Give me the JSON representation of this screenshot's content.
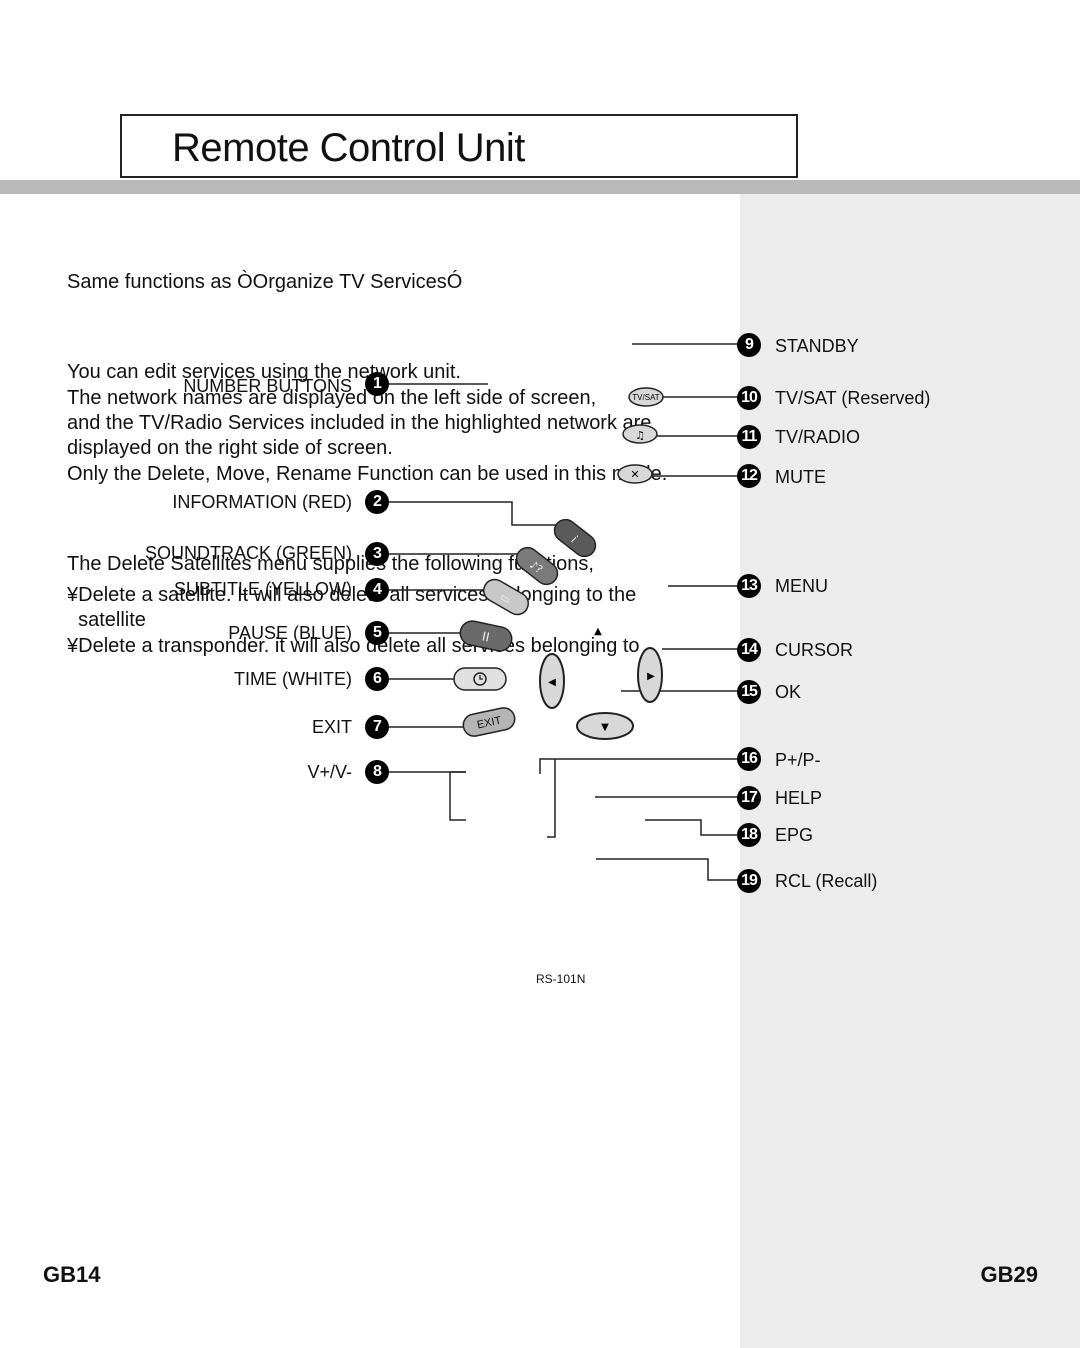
{
  "header": {
    "title": "Remote Control Unit"
  },
  "body_text": {
    "same_functions": "Same functions as ÒOrganize TV ServicesÓ",
    "paragraph1": [
      "You can edit services using the network unit.",
      "The network names are displayed on the left side of screen,",
      "and the TV/Radio Services included in the highlighted network are",
      "displayed on the right side of screen.",
      "Only the Delete, Move, Rename Function can be used in this mode."
    ],
    "paragraph2": [
      "The Delete Satellites menu supplies the following functions,",
      "¥Delete a satellite. It will also delete all services belonging to the",
      "  satellite",
      "¥Delete a transponder. it will also delete all services belonging to"
    ]
  },
  "left_callouts": [
    {
      "number": "1",
      "label": "NUMBER BUTTONS"
    },
    {
      "number": "2",
      "label": "INFORMATION (RED)"
    },
    {
      "number": "3",
      "label": "SOUNDTRACK (GREEN)"
    },
    {
      "number": "4",
      "label": "SUBTITLE (YELLOW)"
    },
    {
      "number": "5",
      "label": "PAUSE (BLUE)"
    },
    {
      "number": "6",
      "label": "TIME (WHITE)"
    },
    {
      "number": "7",
      "label": "EXIT"
    },
    {
      "number": "8",
      "label": "V+/V-"
    }
  ],
  "right_callouts": [
    {
      "number": "9",
      "label": "STANDBY"
    },
    {
      "number": "10",
      "label": "TV/SAT (Reserved)"
    },
    {
      "number": "11",
      "label": "TV/RADIO"
    },
    {
      "number": "12",
      "label": "MUTE"
    },
    {
      "number": "13",
      "label": "MENU"
    },
    {
      "number": "14",
      "label": "CURSOR"
    },
    {
      "number": "15",
      "label": "OK"
    },
    {
      "number": "16",
      "label": "P+/P-"
    },
    {
      "number": "17",
      "label": "HELP"
    },
    {
      "number": "18",
      "label": "EPG"
    },
    {
      "number": "19",
      "label": "RCL (Recall)"
    }
  ],
  "remote_buttons": {
    "tv_sat": "TV/SAT",
    "exit": "EXIT",
    "cursor_up": "▲",
    "cursor_left": "◀",
    "cursor_right": "▶",
    "cursor_down": "▼"
  },
  "model_name": "RS-101N",
  "footer": {
    "left_page": "GB14",
    "right_page": "GB29"
  }
}
